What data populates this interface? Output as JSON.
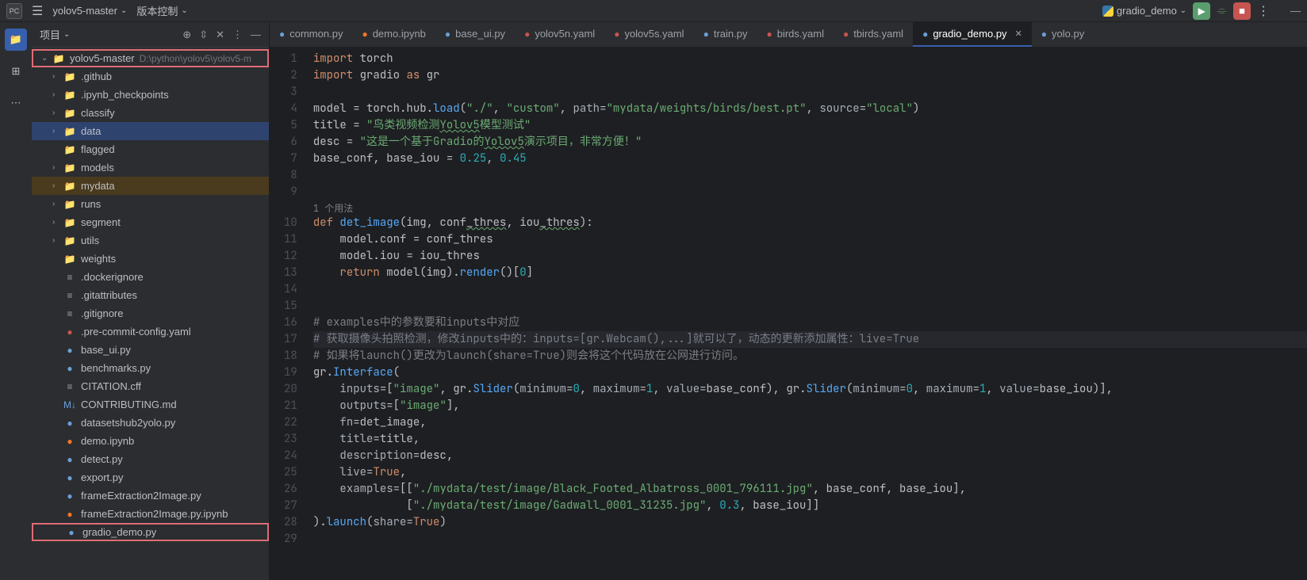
{
  "topbar": {
    "project_name": "yolov5-master",
    "vcs_label": "版本控制",
    "run_config": "gradio_demo"
  },
  "sidebar": {
    "title": "项目",
    "root": {
      "name": "yolov5-master",
      "path": "D:\\python\\yolov5\\yolov5-m"
    },
    "folders": [
      {
        "name": ".github"
      },
      {
        "name": ".ipynb_checkpoints"
      },
      {
        "name": "classify"
      },
      {
        "name": "data",
        "selected": true
      },
      {
        "name": "flagged",
        "noExpand": true
      },
      {
        "name": "models"
      },
      {
        "name": "mydata",
        "hlOrange": true
      },
      {
        "name": "runs"
      },
      {
        "name": "segment"
      },
      {
        "name": "utils"
      },
      {
        "name": "weights",
        "noExpand": true
      }
    ],
    "files": [
      {
        "name": ".dockerignore",
        "icon": "file"
      },
      {
        "name": ".gitattributes",
        "icon": "file"
      },
      {
        "name": ".gitignore",
        "icon": "file"
      },
      {
        "name": ".pre-commit-config.yaml",
        "icon": "yaml"
      },
      {
        "name": "base_ui.py",
        "icon": "py"
      },
      {
        "name": "benchmarks.py",
        "icon": "py"
      },
      {
        "name": "CITATION.cff",
        "icon": "file"
      },
      {
        "name": "CONTRIBUTING.md",
        "icon": "md"
      },
      {
        "name": "datasetshub2yolo.py",
        "icon": "py"
      },
      {
        "name": "demo.ipynb",
        "icon": "jup"
      },
      {
        "name": "detect.py",
        "icon": "py"
      },
      {
        "name": "export.py",
        "icon": "py"
      },
      {
        "name": "frameExtraction2Image.py",
        "icon": "py"
      },
      {
        "name": "frameExtraction2Image.py.ipynb",
        "icon": "jup"
      },
      {
        "name": "gradio_demo.py",
        "icon": "py",
        "boxed": true
      }
    ]
  },
  "tabs": [
    {
      "label": "common.py",
      "icon": "py"
    },
    {
      "label": "demo.ipynb",
      "icon": "jup"
    },
    {
      "label": "base_ui.py",
      "icon": "py"
    },
    {
      "label": "yolov5n.yaml",
      "icon": "yaml"
    },
    {
      "label": "yolov5s.yaml",
      "icon": "yaml"
    },
    {
      "label": "train.py",
      "icon": "py"
    },
    {
      "label": "birds.yaml",
      "icon": "yaml"
    },
    {
      "label": "tbirds.yaml",
      "icon": "yaml"
    },
    {
      "label": "gradio_demo.py",
      "icon": "py",
      "active": true
    },
    {
      "label": "yolo.py",
      "icon": "py"
    }
  ],
  "code": {
    "hint": "1 个用法",
    "lines": [
      {
        "n": 1,
        "html": "<span class='kw'>import</span> <span class='id'>torch</span>"
      },
      {
        "n": 2,
        "html": "<span class='kw'>import</span> <span class='id'>gradio</span> <span class='kw'>as</span> <span class='id'>gr</span>"
      },
      {
        "n": 3,
        "html": ""
      },
      {
        "n": 4,
        "html": "<span class='id'>model</span> <span class='op'>=</span> <span class='id'>torch.hub.<span class='fn'>load</span></span>(<span class='str'>\"./\"</span>, <span class='str'>\"custom\"</span>, <span class='param'>path</span><span class='op'>=</span><span class='str'>\"mydata/weights/birds/best.pt\"</span>, <span class='param'>source</span><span class='op'>=</span><span class='str'>\"local\"</span>)"
      },
      {
        "n": 5,
        "html": "<span class='id'>title</span> <span class='op'>=</span> <span class='str'>\"鸟类视频检测<span class='wavy'>Yolov5</span>模型测试\"</span>"
      },
      {
        "n": 6,
        "html": "<span class='id'>desc</span> <span class='op'>=</span> <span class='str'>\"这是一个基于Gradio的<span class='wavy'>Yolov5</span>演示项目，非常方便！\"</span>"
      },
      {
        "n": 7,
        "html": "<span class='id'>base_conf, base_iou</span> <span class='op'>=</span> <span class='num'>0.25</span>, <span class='num'>0.45</span>"
      },
      {
        "n": 8,
        "html": ""
      },
      {
        "n": 9,
        "html": ""
      },
      {
        "n": 10,
        "html": "<span class='kw'>def</span> <span class='fn'>det_image</span>(img, conf<span class='wavy'>_thres</span>, iou<span class='wavy'>_thres</span>):"
      },
      {
        "n": 11,
        "html": "    <span class='id'>model.conf</span> <span class='op'>=</span> <span class='id'>conf_thres</span>"
      },
      {
        "n": 12,
        "html": "    <span class='id'>model.iou</span> <span class='op'>=</span> <span class='id'>iou_thres</span>"
      },
      {
        "n": 13,
        "html": "    <span class='kw'>return</span> <span class='id'>model</span>(img).<span class='fn'>render</span>()[<span class='num'>0</span>]"
      },
      {
        "n": 14,
        "html": ""
      },
      {
        "n": 15,
        "html": ""
      },
      {
        "n": 16,
        "html": "<span class='comment'># examples中的参数要和inputs中对应</span>"
      },
      {
        "n": 17,
        "html": "<span class='comment'># 获取摄像头拍照检测，修改inputs中的：inputs=[gr.Webcam(),...]就可以了，动态的更新添加属性：live=True</span>",
        "hl": true
      },
      {
        "n": 18,
        "html": "<span class='comment'># 如果将launch()更改为launch(share=True)则会将这个代码放在公网进行访问。</span>"
      },
      {
        "n": 19,
        "html": "<span class='id'>gr.<span class='fn'>Interface</span></span>("
      },
      {
        "n": 20,
        "html": "    <span class='param'>inputs</span><span class='op'>=</span>[<span class='str'>\"image\"</span>, gr.<span class='fn'>Slider</span>(<span class='param'>minimum</span><span class='op'>=</span><span class='num'>0</span>, <span class='param'>maximum</span><span class='op'>=</span><span class='num'>1</span>, <span class='param'>value</span><span class='op'>=</span>base_conf), gr.<span class='fn'>Slider</span>(<span class='param'>minimum</span><span class='op'>=</span><span class='num'>0</span>, <span class='param'>maximum</span><span class='op'>=</span><span class='num'>1</span>, <span class='param'>value</span><span class='op'>=</span>base_iou)],"
      },
      {
        "n": 21,
        "html": "    <span class='param'>outputs</span><span class='op'>=</span>[<span class='str'>\"image\"</span>],"
      },
      {
        "n": 22,
        "html": "    <span class='param'>fn</span><span class='op'>=</span>det_image,"
      },
      {
        "n": 23,
        "html": "    <span class='param'>title</span><span class='op'>=</span>title,"
      },
      {
        "n": 24,
        "html": "    <span class='param'>description</span><span class='op'>=</span>desc,"
      },
      {
        "n": 25,
        "html": "    <span class='param'>live</span><span class='op'>=</span><span class='kw'>True</span>,"
      },
      {
        "n": 26,
        "html": "    <span class='param'>examples</span><span class='op'>=</span>[[<span class='str'>\"./mydata/test/image/Black_Footed_Albatross_0001_796111.jpg\"</span>, base_conf, base_iou],"
      },
      {
        "n": 27,
        "html": "              [<span class='str'>\"./mydata/test/image/Gadwall_0001_31235.jpg\"</span>, <span class='num'>0.3</span>, base_iou]]"
      },
      {
        "n": 28,
        "html": ").<span class='fn'>launch</span>(<span class='param'>share</span><span class='op'>=</span><span class='kw'>True</span>)"
      },
      {
        "n": 29,
        "html": ""
      }
    ]
  }
}
